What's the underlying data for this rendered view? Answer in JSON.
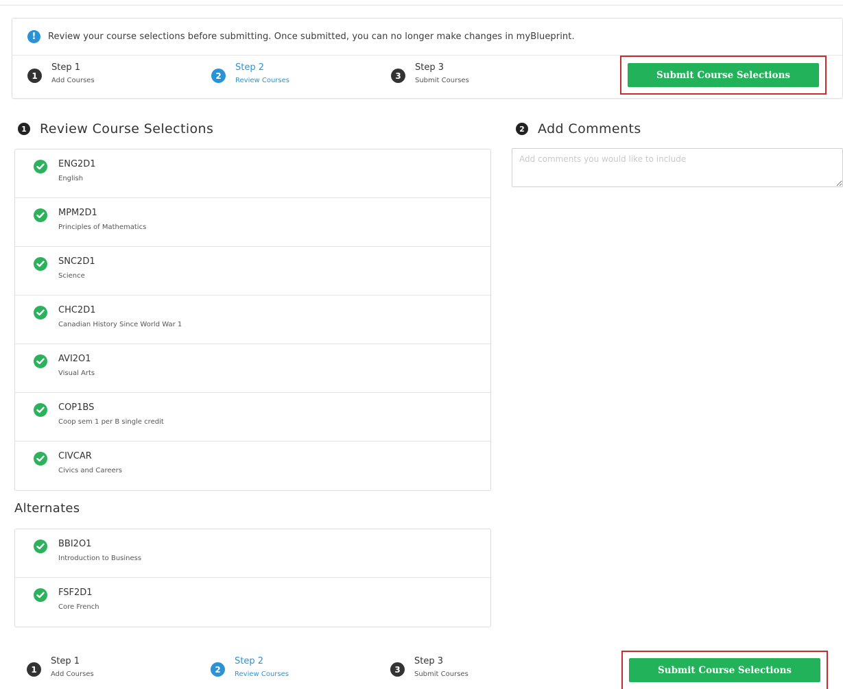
{
  "info": {
    "icon": "info-icon",
    "icon_glyph": "!",
    "message": "Review your course selections before submitting. Once submitted, you can no longer make changes in myBlueprint."
  },
  "steps": [
    {
      "num": "1",
      "title": "Step 1",
      "subtitle": "Add Courses",
      "active": false
    },
    {
      "num": "2",
      "title": "Step 2",
      "subtitle": "Review Courses",
      "active": true
    },
    {
      "num": "3",
      "title": "Step 3",
      "subtitle": "Submit Courses",
      "active": false
    }
  ],
  "submit_label": "Submit Course Selections",
  "review": {
    "num": "1",
    "heading": "Review Course Selections",
    "courses": [
      {
        "code": "ENG2D1",
        "name": "English"
      },
      {
        "code": "MPM2D1",
        "name": "Principles of Mathematics"
      },
      {
        "code": "SNC2D1",
        "name": "Science"
      },
      {
        "code": "CHC2D1",
        "name": "Canadian History Since World War 1"
      },
      {
        "code": "AVI2O1",
        "name": "Visual Arts"
      },
      {
        "code": "COP1BS",
        "name": "Coop sem 1 per B single credit"
      },
      {
        "code": "CIVCAR",
        "name": "Civics and Careers"
      }
    ]
  },
  "alternates": {
    "heading": "Alternates",
    "courses": [
      {
        "code": "BBI2O1",
        "name": "Introduction to Business"
      },
      {
        "code": "FSF2D1",
        "name": "Core French"
      }
    ]
  },
  "comments": {
    "num": "2",
    "heading": "Add Comments",
    "placeholder": "Add comments you would like to include"
  },
  "colors": {
    "accent_blue": "#2a93d8",
    "submit_green": "#22b259",
    "check_green": "#2cb25c",
    "highlight_red": "#c92a2a"
  }
}
